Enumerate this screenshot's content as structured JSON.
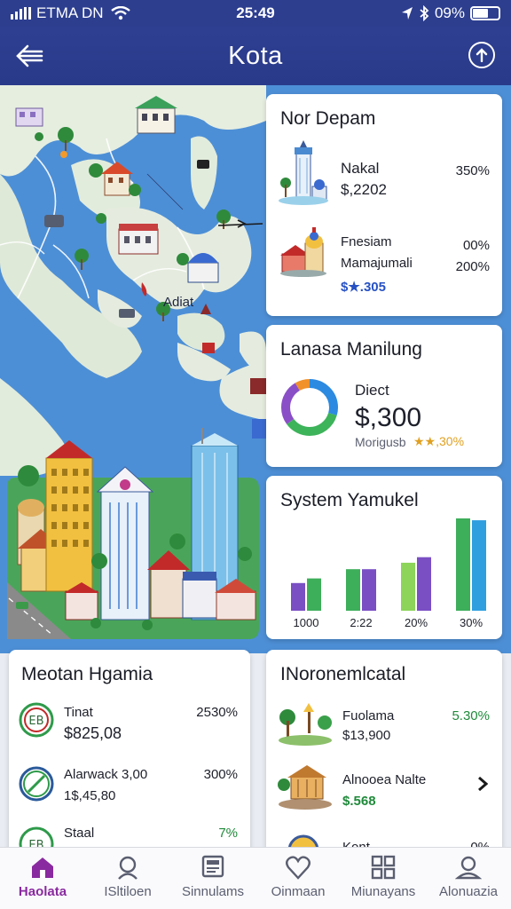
{
  "status_bar": {
    "carrier": "ETMA DN",
    "time": "25:49",
    "battery": "09%",
    "battery_level": 0.6,
    "icons": [
      "signal-icon",
      "wifi-icon",
      "location-icon",
      "bluetooth-icon",
      "battery-icon"
    ]
  },
  "header": {
    "title": "Kota",
    "back_icon": "arrow-left-icon",
    "action_icon": "arrow-up-circle-icon"
  },
  "map": {
    "label": "Adiat"
  },
  "card_top": {
    "title": "Nor Depam",
    "items": [
      {
        "name": "Nakal",
        "value": "$,2202",
        "pct1": "350%",
        "pct2": ""
      },
      {
        "name": "Fnesiam",
        "name2": "Mamajumali",
        "value": "$★.305",
        "pct1": "00%",
        "pct2": "200%"
      }
    ]
  },
  "card_donut": {
    "title": "Lanasa Manilung",
    "label": "Diect",
    "amount": "$,300",
    "sub_label": "Morigusb",
    "sub_value": "★★,30%",
    "colors": [
      "#2c8ae0",
      "#3db35a",
      "#8a4fc7",
      "#f0912a"
    ]
  },
  "card_bars": {
    "title": "System Yamukel",
    "chart_data": {
      "type": "bar",
      "categories": [
        "1000",
        "2:22",
        "20%",
        "30%"
      ],
      "series": [
        {
          "values": [
            30,
            45,
            52,
            100
          ],
          "color": "#7a4fc4"
        },
        {
          "values": [
            35,
            45,
            58,
            98
          ],
          "color": "#3dae5a"
        }
      ],
      "colors_by_category": [
        [
          "#7a4fc4",
          "#3dae5a"
        ],
        [
          "#3dae5a",
          "#7a4fc4"
        ],
        [
          "#8cd45a",
          "#7a4fc4"
        ],
        [
          "#3dae5a",
          "#2f9fe0"
        ]
      ]
    }
  },
  "card_meotan": {
    "title": "Meotan Hgamia",
    "rows": [
      {
        "name": "Tinat",
        "value": "$825,08",
        "pct": "2530%",
        "pct_color": "#1d1f2a"
      },
      {
        "name": "Alarwack 3,00",
        "value": "1$,45,80",
        "pct": "300%",
        "pct_color": "#1d1f2a"
      },
      {
        "name": "Staal",
        "value": "",
        "pct": "7%",
        "pct_color": "#1f8a3a"
      }
    ]
  },
  "card_noron": {
    "title": "INoronemlcatal",
    "rows": [
      {
        "name": "Fuolama",
        "value": "$13,900",
        "pct": "5.30%"
      },
      {
        "name": "Alnooea Nalte",
        "value": "$.568",
        "pct": ""
      },
      {
        "name": "Kont",
        "value": "",
        "pct": "0%"
      }
    ]
  },
  "nav": {
    "items": [
      {
        "label": "Haolata",
        "icon": "home-icon",
        "active": true
      },
      {
        "label": "ISltiloen",
        "icon": "search-icon",
        "active": false
      },
      {
        "label": "Sinnulams",
        "icon": "register-icon",
        "active": false
      },
      {
        "label": "Oinmaan",
        "icon": "heart-icon",
        "active": false
      },
      {
        "label": "Miunayans",
        "icon": "grid-icon",
        "active": false
      },
      {
        "label": "Alonuazia",
        "icon": "profile-icon",
        "active": false
      }
    ]
  }
}
